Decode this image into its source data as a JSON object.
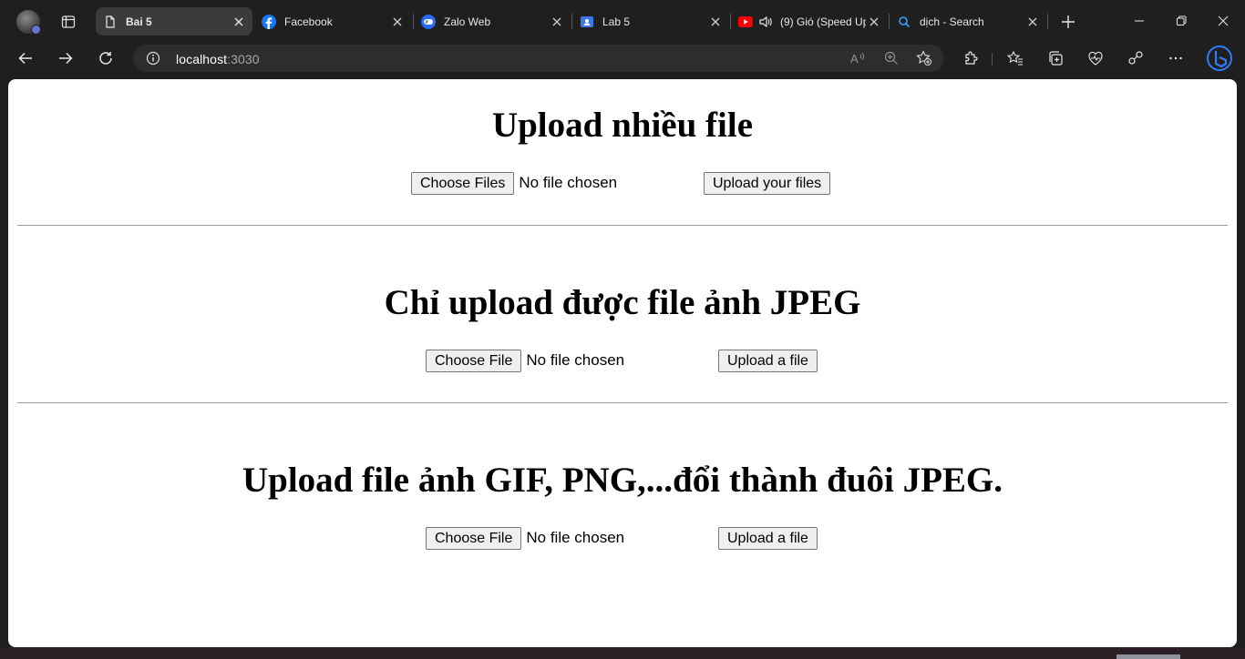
{
  "browser": {
    "tabs": [
      {
        "title": "Bai 5",
        "favicon": "page-icon",
        "active": true
      },
      {
        "title": "Facebook",
        "favicon": "facebook-icon",
        "active": false
      },
      {
        "title": "Zalo Web",
        "favicon": "zalo-icon",
        "active": false
      },
      {
        "title": "Lab 5",
        "favicon": "classroom-icon",
        "active": false
      },
      {
        "title": "(9) Gió (Speed Up",
        "favicon": "youtube-icon",
        "audio": true,
        "active": false
      },
      {
        "title": "dịch - Search",
        "favicon": "bing-search-icon",
        "active": false
      }
    ],
    "address": {
      "host": "localhost",
      "port": ":3030"
    }
  },
  "page": {
    "sections": [
      {
        "heading": "Upload nhiều file",
        "choose_label": "Choose Files",
        "status": "No file chosen",
        "submit_label": "Upload your files"
      },
      {
        "heading": "Chỉ upload được file ảnh JPEG",
        "choose_label": "Choose File",
        "status": "No file chosen",
        "submit_label": "Upload a file"
      },
      {
        "heading": "Upload file ảnh GIF, PNG,...đổi thành đuôi JPEG.",
        "choose_label": "Choose File",
        "status": "No file chosen",
        "submit_label": "Upload a file"
      }
    ]
  },
  "colors": {
    "chrome_bg": "#1f1f1f",
    "active_tab": "#3b3b3b",
    "omnibox": "#2d2d2d",
    "page_bg": "#ffffff",
    "rule": "#9a9a9a"
  }
}
